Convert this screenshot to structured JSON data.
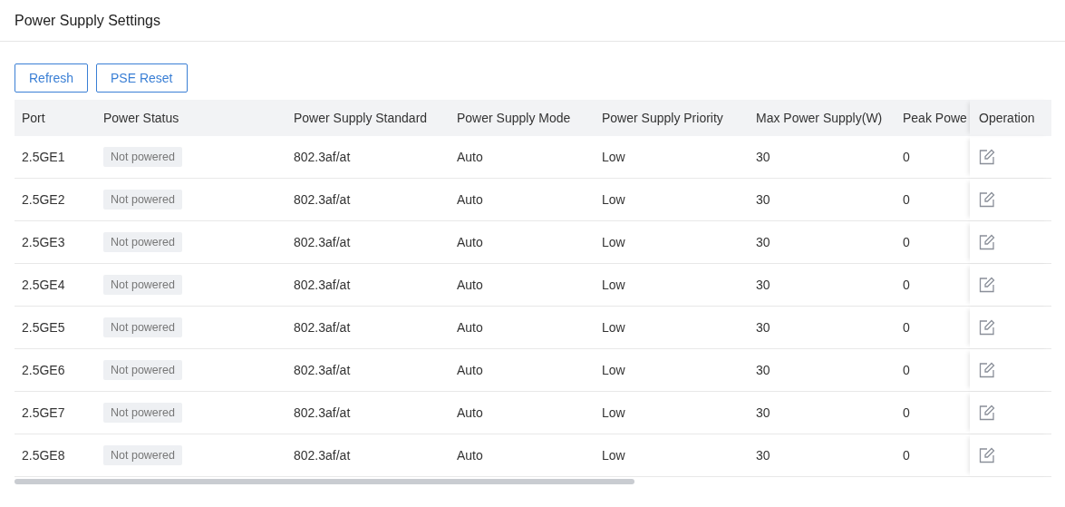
{
  "title": "Power Supply Settings",
  "buttons": [
    "Refresh",
    "PSE Reset"
  ],
  "table": {
    "columns": [
      "Port",
      "Power Status",
      "Power Supply Standard",
      "Power Supply Mode",
      "Power Supply Priority",
      "Max Power Supply(W)",
      "Peak Powe",
      "Operation"
    ],
    "rows": [
      {
        "port": "2.5GE1",
        "status": "Not powered",
        "standard": "802.3af/at",
        "mode": "Auto",
        "priority": "Low",
        "max": "30",
        "peak": "0"
      },
      {
        "port": "2.5GE2",
        "status": "Not powered",
        "standard": "802.3af/at",
        "mode": "Auto",
        "priority": "Low",
        "max": "30",
        "peak": "0"
      },
      {
        "port": "2.5GE3",
        "status": "Not powered",
        "standard": "802.3af/at",
        "mode": "Auto",
        "priority": "Low",
        "max": "30",
        "peak": "0"
      },
      {
        "port": "2.5GE4",
        "status": "Not powered",
        "standard": "802.3af/at",
        "mode": "Auto",
        "priority": "Low",
        "max": "30",
        "peak": "0"
      },
      {
        "port": "2.5GE5",
        "status": "Not powered",
        "standard": "802.3af/at",
        "mode": "Auto",
        "priority": "Low",
        "max": "30",
        "peak": "0"
      },
      {
        "port": "2.5GE6",
        "status": "Not powered",
        "standard": "802.3af/at",
        "mode": "Auto",
        "priority": "Low",
        "max": "30",
        "peak": "0"
      },
      {
        "port": "2.5GE7",
        "status": "Not powered",
        "standard": "802.3af/at",
        "mode": "Auto",
        "priority": "Low",
        "max": "30",
        "peak": "0"
      },
      {
        "port": "2.5GE8",
        "status": "Not powered",
        "standard": "802.3af/at",
        "mode": "Auto",
        "priority": "Low",
        "max": "30",
        "peak": "0"
      }
    ]
  }
}
